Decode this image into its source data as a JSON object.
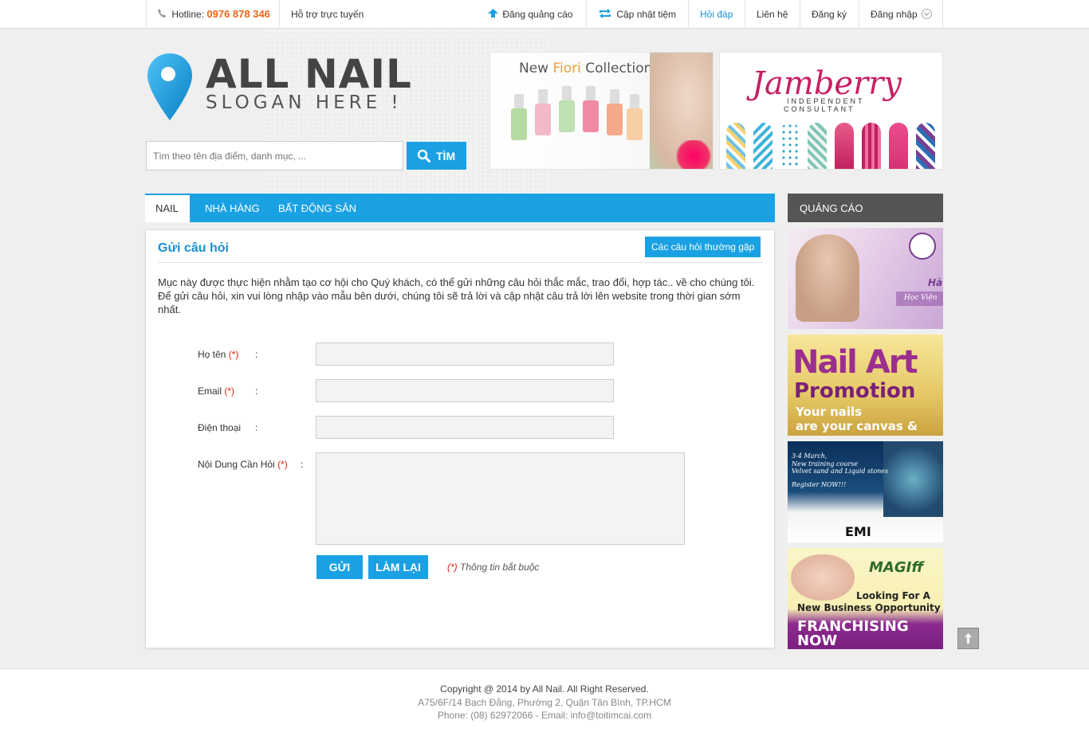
{
  "topbar": {
    "hotline_label": "Hotline:",
    "hotline_number": "0976 878 346",
    "support": "Hỗ trợ trực tuyến",
    "post_ad": "Đăng quảng cáo",
    "update_shop": "Cập nhật tiệm",
    "faq": "Hỏi đáp",
    "contact": "Liên hệ",
    "register": "Đăng ký",
    "login": "Đăng nhập"
  },
  "header": {
    "logo_title": "ALL NAIL",
    "logo_slogan": "SLOGAN HERE !",
    "search_placeholder": "Tìm theo tên địa điểm, danh mục, ...",
    "search_button": "TÌM"
  },
  "banners": {
    "banner1_title_new": "New ",
    "banner1_title_fiori": "Fiori",
    "banner1_title_collection": " Collection",
    "banner2_title": "Jamberry",
    "banner2_sub1": "INDEPENDENT",
    "banner2_sub2": "CONSULTANT"
  },
  "nav": {
    "tabs": [
      "NAIL",
      "NHÀ HÀNG",
      "BẤT ĐỘNG SẢN"
    ]
  },
  "form": {
    "title": "Gửi câu hỏi",
    "faq_button": "Các câu hỏi thường gặp",
    "intro_1": "Mục này được thực hiện nhằm tạo cơ hội cho Quý khách, có thể gửi những câu hỏi thắc mắc, trao đổi, hợp tác.. về cho chúng tôi.",
    "intro_2": "Để gửi câu hỏi, xin vui lòng nhập vào mẫu bên dưới, chúng tôi sẽ trả lời và cập nhật câu trả lời lên website trong thời gian sớm nhất.",
    "label_name": "Họ tên",
    "label_email": "Email",
    "label_phone": "Điện thoại",
    "label_content": "Nội Dung Cần Hỏi",
    "required_mark": "(*)",
    "colon": ":",
    "send_button": "GỬI",
    "reset_button": "LÀM LẠI",
    "required_note": "Thông tin bắt buộc"
  },
  "sidebar": {
    "title": "QUẢNG CÁO",
    "ad1_text": "Hà",
    "ad1_sub": "Học Viện",
    "ad2_line1": "Nail Art",
    "ad2_line2": "Promotion",
    "ad2_line3": "Your nails",
    "ad2_line4": "are your canvas &",
    "ad3_line1": "3-4 March,",
    "ad3_line2": "New training course",
    "ad3_line3": "Velvet sand and Liquid stones",
    "ad3_line4": "Register NOW!!!",
    "ad3_brand": "EMI",
    "ad4_brand": "MAGIff",
    "ad4_line1": "Looking For A",
    "ad4_line2": "New Business Opportunity",
    "ad4_line3": "FRANCHISING",
    "ad4_line4": "NOW"
  },
  "footer": {
    "copyright": "Copyright @ 2014 by All Nail. All Right Reserved.",
    "address": "A75/6F/14 Bạch Đằng, Phường 2, Quận Tân Bình, TP.HCM",
    "contact": "Phone: (08) 62972066 - Email: info@toitimcai.com"
  },
  "colors": {
    "accent": "#1aa1e3",
    "hotline": "#e8661c",
    "required": "#dd2211"
  }
}
